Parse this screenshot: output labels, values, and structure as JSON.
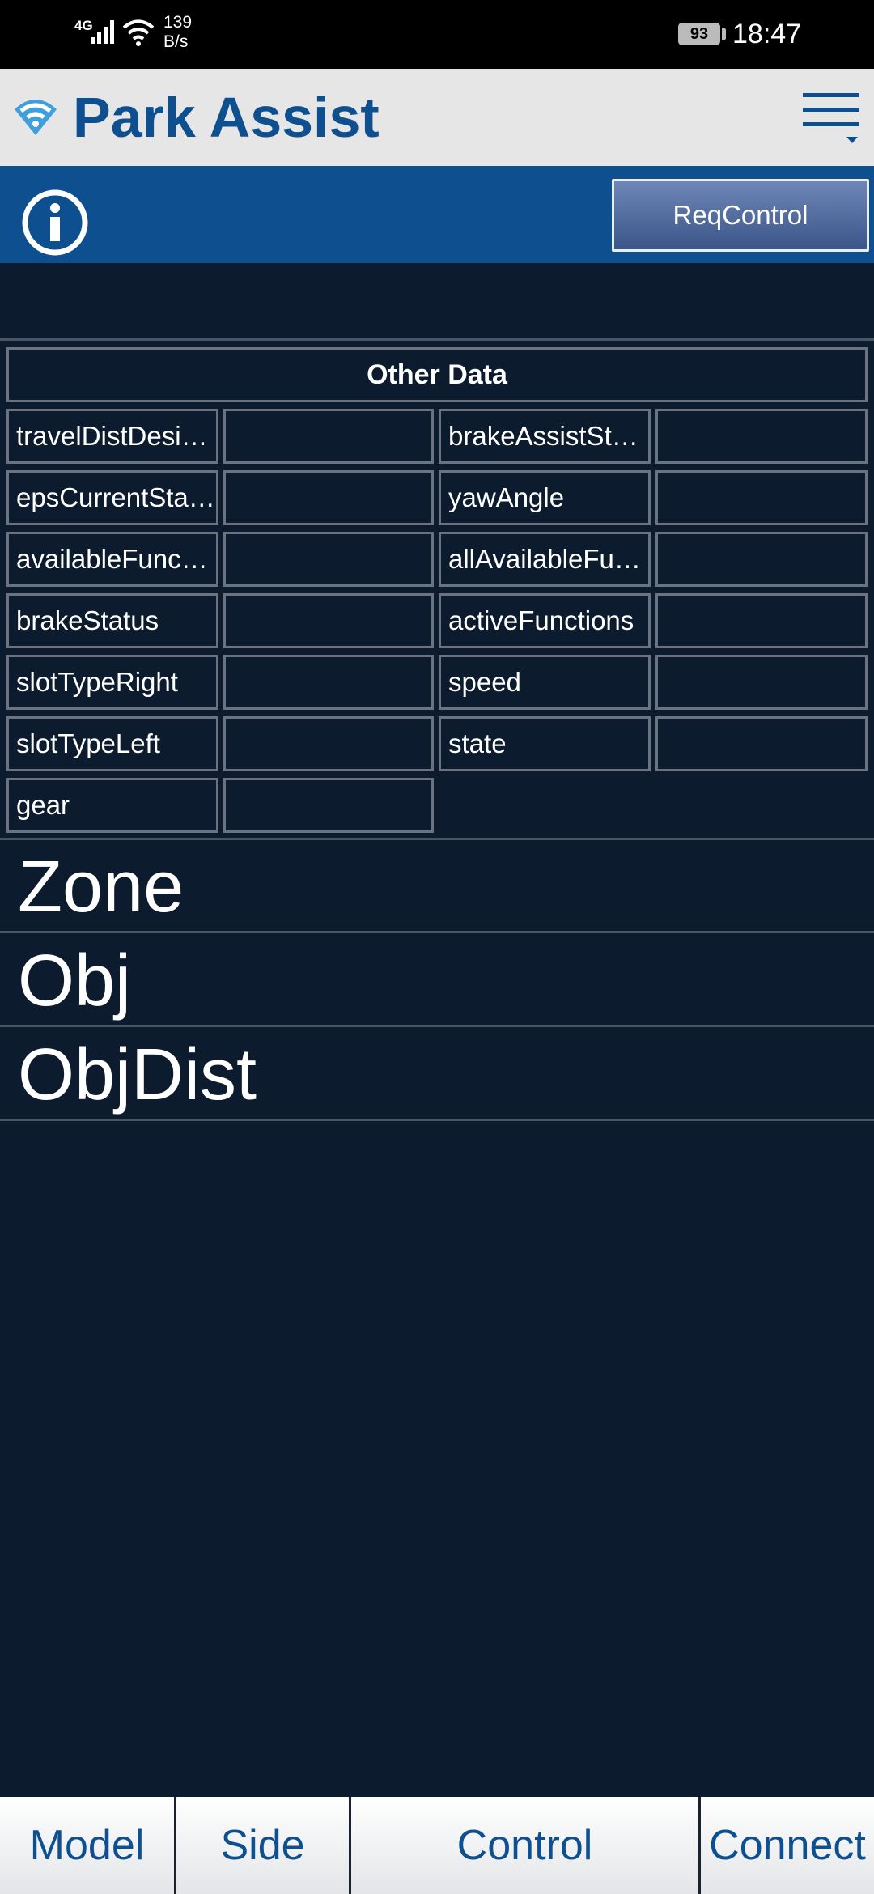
{
  "status_bar": {
    "network": "4G",
    "speed_value": "139",
    "speed_unit": "B/s",
    "battery": "93",
    "time": "18:47"
  },
  "header": {
    "title": "Park Assist",
    "logo_icon": "wifi-shield-logo-icon",
    "menu_icon": "hamburger-menu-icon"
  },
  "toolbar": {
    "info_icon": "info-icon",
    "req_control_label": "ReqControl"
  },
  "other_data": {
    "title": "Other Data",
    "rows": [
      {
        "left_label": "travelDistDesi…",
        "left_value": "",
        "right_label": "brakeAssistSt…",
        "right_value": ""
      },
      {
        "left_label": "epsCurrentSta…",
        "left_value": "",
        "right_label": "yawAngle",
        "right_value": ""
      },
      {
        "left_label": "availableFunc…",
        "left_value": "",
        "right_label": "allAvailableFu…",
        "right_value": ""
      },
      {
        "left_label": "brakeStatus",
        "left_value": "",
        "right_label": "activeFunctions",
        "right_value": ""
      },
      {
        "left_label": "slotTypeRight",
        "left_value": "",
        "right_label": "speed",
        "right_value": ""
      },
      {
        "left_label": "slotTypeLeft",
        "left_value": "",
        "right_label": "state",
        "right_value": ""
      },
      {
        "left_label": "gear",
        "left_value": ""
      }
    ]
  },
  "sections": [
    "Zone",
    "Obj",
    "ObjDist"
  ],
  "bottom_nav": [
    "Model",
    "Side",
    "Control",
    "Connect"
  ],
  "colors": {
    "brand_blue": "#0d4f8f",
    "background": "#0d1b2e",
    "header_bg": "#e6e6e6"
  }
}
